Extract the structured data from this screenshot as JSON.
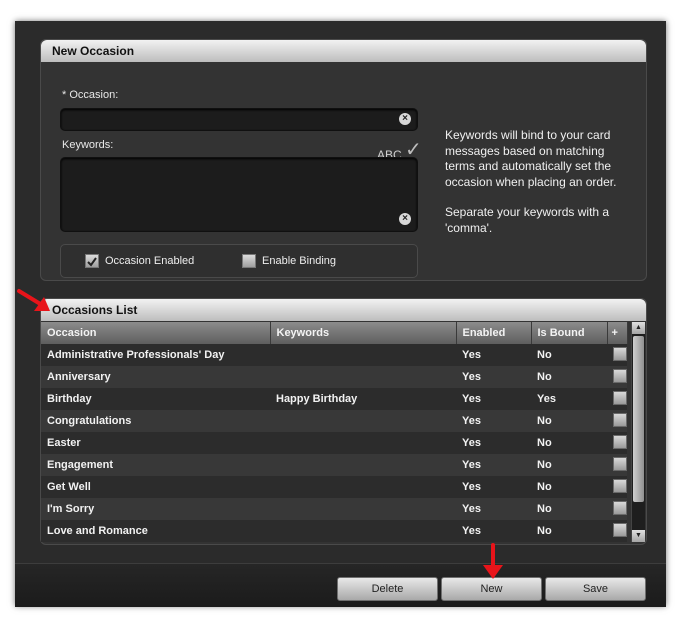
{
  "new_occasion": {
    "title": "New Occasion",
    "occasion_label": "* Occasion:",
    "occasion_value": "",
    "keywords_label": "Keywords:",
    "keywords_value": "",
    "spellcheck_label": "ABC",
    "description": [
      "Keywords will bind to your card messages based on matching terms and automatically set the occasion when placing an order.",
      "Separate your keywords with a 'comma'."
    ],
    "occasion_enabled_label": "Occasion Enabled",
    "occasion_enabled_checked": true,
    "enable_binding_label": "Enable Binding",
    "enable_binding_checked": false
  },
  "occasions_list": {
    "title": "Occasions List",
    "columns": [
      "Occasion",
      "Keywords",
      "Enabled",
      "Is Bound",
      "+"
    ],
    "rows": [
      {
        "occasion": "Administrative Professionals' Day",
        "keywords": "",
        "enabled": "Yes",
        "is_bound": "No"
      },
      {
        "occasion": "Anniversary",
        "keywords": "",
        "enabled": "Yes",
        "is_bound": "No"
      },
      {
        "occasion": "Birthday",
        "keywords": "Happy Birthday",
        "enabled": "Yes",
        "is_bound": "Yes"
      },
      {
        "occasion": "Congratulations",
        "keywords": "",
        "enabled": "Yes",
        "is_bound": "No"
      },
      {
        "occasion": "Easter",
        "keywords": "",
        "enabled": "Yes",
        "is_bound": "No"
      },
      {
        "occasion": "Engagement",
        "keywords": "",
        "enabled": "Yes",
        "is_bound": "No"
      },
      {
        "occasion": "Get Well",
        "keywords": "",
        "enabled": "Yes",
        "is_bound": "No"
      },
      {
        "occasion": "I'm Sorry",
        "keywords": "",
        "enabled": "Yes",
        "is_bound": "No"
      },
      {
        "occasion": "Love and Romance",
        "keywords": "",
        "enabled": "Yes",
        "is_bound": "No"
      }
    ]
  },
  "buttons": {
    "delete": "Delete",
    "new": "New",
    "save": "Save"
  },
  "colors": {
    "annotation_arrow": "#e8141a",
    "panel_background": "#333333",
    "window_background": "#2b2b2b"
  }
}
